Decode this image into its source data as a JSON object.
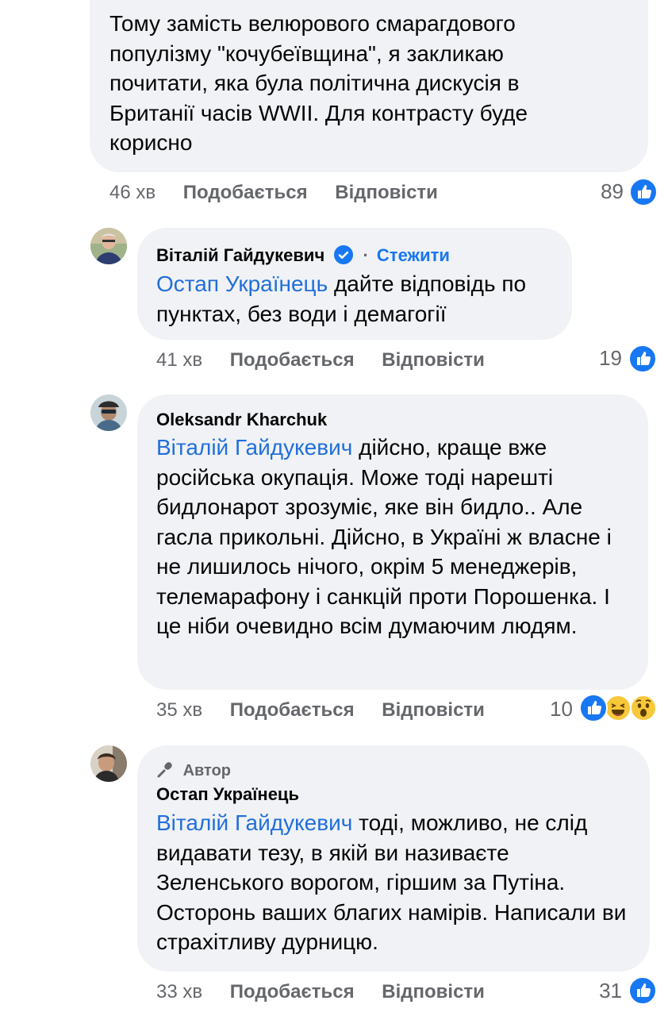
{
  "comments": [
    {
      "text": "Тому замість велюрового смарагдового популізму \"кочубеївщина\", я закликаю почитати, яка була політична дискусія в Британії часів WWII. Для контрасту буде корисно",
      "time": "46 хв",
      "like_label": "Подобається",
      "reply_label": "Відповісти",
      "reactions": "89",
      "reaction_icons": [
        "like-icon"
      ]
    },
    {
      "author": "Віталій Гайдукевич",
      "verified": true,
      "follow_separator": "·",
      "follow_label": "Стежити",
      "mention": "Остап Украïнець",
      "text": "дайте відповідь по пунктах, без води і демагогії",
      "time": "41 хв",
      "like_label": "Подобається",
      "reply_label": "Відповісти",
      "reactions": "19",
      "reaction_icons": [
        "like-icon"
      ]
    },
    {
      "author": "Oleksandr Kharchuk",
      "mention": "Віталій Гайдукевич",
      "text": "дійсно, краще вже російська окупація. Може тоді нарешті бидлонарот зрозуміє, яке він бидло.. Але гасла прикольні. Дійсно, в Україні ж власне і не лишилось нічого, окрім 5 менеджерів, телемарафону і санкцій проти Порошенка. І це ніби очевидно всім думаючим людям.",
      "time": "35 хв",
      "like_label": "Подобається",
      "reply_label": "Відповісти",
      "reactions": "10",
      "reaction_icons": [
        "like-icon",
        "laugh-icon",
        "wow-icon"
      ]
    },
    {
      "badge": "Автор",
      "author": "Остап Украïнець",
      "mention": "Віталій Гайдукевич",
      "text": "тоді, можливо, не слід видавати тезу, в якій ви називаєте Зеленського ворогом, гіршим за Путіна. Осторонь ваших благих намірів. Написали ви страхітливу дурницю.",
      "time": "33 хв",
      "like_label": "Подобається",
      "reply_label": "Відповісти",
      "reactions": "31",
      "reaction_icons": [
        "like-icon"
      ]
    }
  ],
  "colors": {
    "bubble": "#f0f2f5",
    "mention": "#216fdb",
    "meta": "#65676b",
    "like": "#1877f2"
  }
}
